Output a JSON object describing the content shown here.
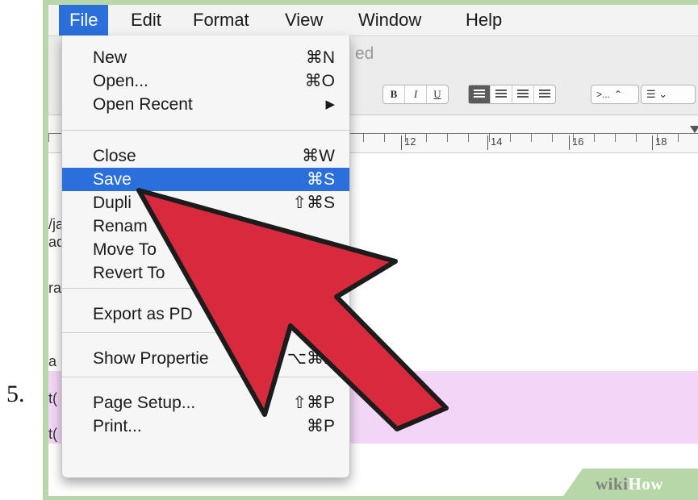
{
  "step_number": "5.",
  "menubar": {
    "items": [
      "File",
      "Edit",
      "Format",
      "View",
      "Window",
      "Help"
    ],
    "active": "File"
  },
  "document": {
    "title_fragment": "ed",
    "format_buttons": [
      "B",
      "I",
      "U"
    ],
    "list_spacing": ">...",
    "ruler_labels": [
      "12",
      "14",
      "16",
      "18"
    ],
    "left_text": [
      "/ja",
      "ad",
      "ra",
      "a",
      "t(",
      "t("
    ],
    "highlight_color": "#f3d6f7"
  },
  "file_menu": {
    "items": [
      {
        "label": "New",
        "shortcut": "⌘N"
      },
      {
        "label": "Open...",
        "shortcut": "⌘O"
      },
      {
        "label": "Open Recent",
        "shortcut": "▶"
      },
      {
        "label": "Close",
        "shortcut": "⌘W"
      },
      {
        "label": "Save",
        "shortcut": "⌘S",
        "highlighted": true
      },
      {
        "label": "Dupli",
        "shortcut": "⇧⌘S"
      },
      {
        "label": "Renam",
        "shortcut": ""
      },
      {
        "label": "Move To",
        "shortcut": ""
      },
      {
        "label": "Revert To",
        "shortcut": ""
      },
      {
        "label": "Export as PD",
        "shortcut": ""
      },
      {
        "label": "Show Propertie",
        "shortcut": "⌥⌘P"
      },
      {
        "label": "Page Setup...",
        "shortcut": "⇧⌘P"
      },
      {
        "label": "Print...",
        "shortcut": "⌘P"
      }
    ],
    "highlight_color": "#2a6fdb"
  },
  "annotation": {
    "arrow_color": "#d82a3c",
    "target": "Save"
  },
  "watermark": {
    "prefix": "wiki",
    "suffix": "How"
  }
}
